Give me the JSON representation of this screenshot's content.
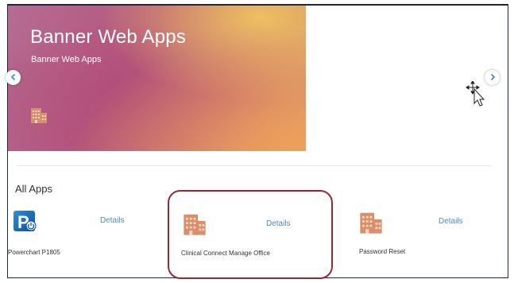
{
  "hero": {
    "title": "Banner Web Apps",
    "subtitle": "Banner Web Apps",
    "icon": "building-icon"
  },
  "carousel": {
    "prev_icon": "chevron-left-icon",
    "next_icon": "chevron-right-icon"
  },
  "all_apps": {
    "heading": "All Apps",
    "apps": [
      {
        "name": "Powerchart P1805",
        "details_label": "Details",
        "icon": "powerchart-icon"
      },
      {
        "name": "Clinical Connect Manage Office",
        "details_label": "Details",
        "icon": "building-icon"
      },
      {
        "name": "Password Reset",
        "details_label": "Details",
        "icon": "building-icon"
      }
    ]
  },
  "colors": {
    "accent_link": "#4b8bc6",
    "building_icon": "#d9906a",
    "highlight_border": "#9a2732"
  }
}
